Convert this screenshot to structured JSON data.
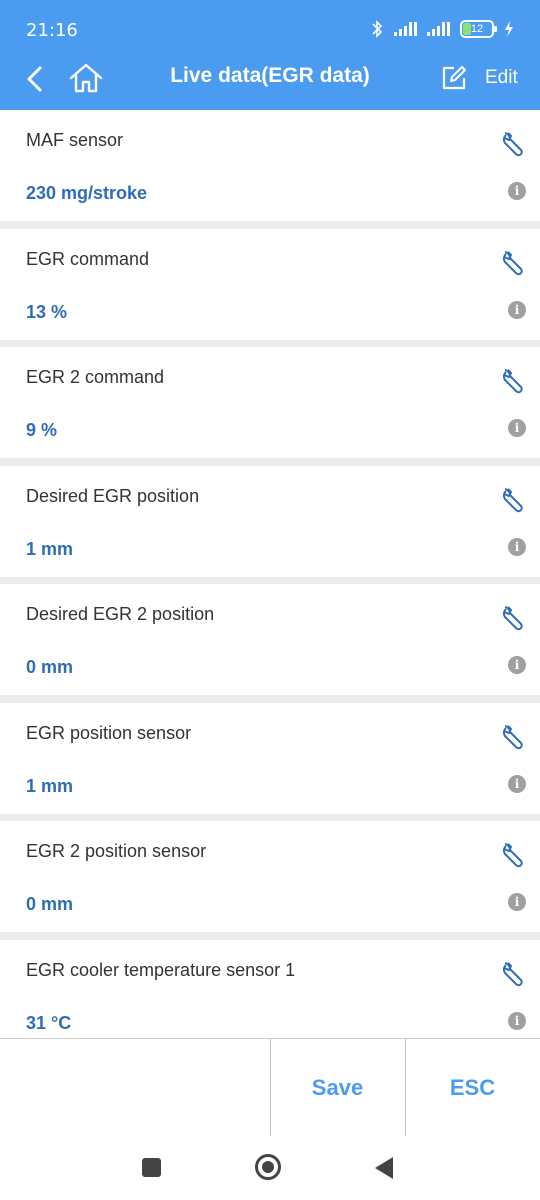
{
  "status_bar": {
    "time": "21:16",
    "battery": "12"
  },
  "app_bar": {
    "title": "Live data(EGR data)",
    "edit_label": "Edit"
  },
  "items": [
    {
      "label": "MAF sensor",
      "value": "230 mg/stroke"
    },
    {
      "label": "EGR command",
      "value": "13 %"
    },
    {
      "label": "EGR 2 command",
      "value": "9 %"
    },
    {
      "label": "Desired EGR position",
      "value": "1 mm"
    },
    {
      "label": "Desired EGR 2 position",
      "value": "0 mm"
    },
    {
      "label": "EGR position sensor",
      "value": "1 mm"
    },
    {
      "label": "EGR 2 position sensor",
      "value": "0 mm"
    },
    {
      "label": "EGR cooler temperature sensor 1",
      "value": "31 °C"
    }
  ],
  "bottom_bar": {
    "save_label": "Save",
    "esc_label": "ESC"
  },
  "info_glyph": "i",
  "colors": {
    "accent": "#4b9cf0",
    "value_text": "#2f6db5",
    "divider": "#ececec"
  }
}
